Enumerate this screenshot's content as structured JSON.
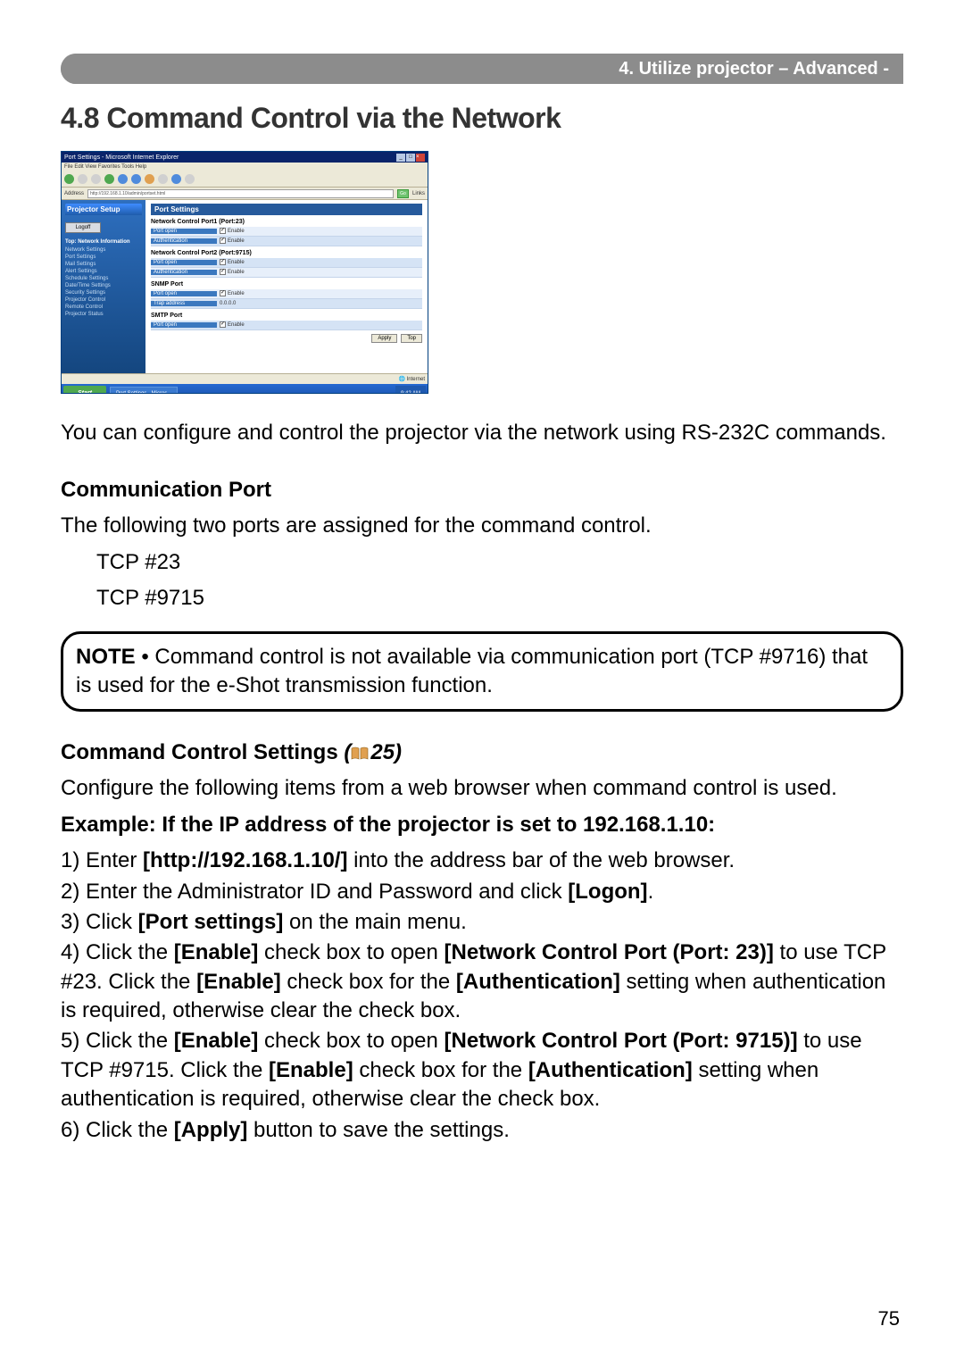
{
  "header": {
    "breadcrumb": "4. Utilize projector – Advanced -"
  },
  "title": "4.8 Command Control via the Network",
  "screenshot": {
    "window_title": "Port Settings - Microsoft Internet Explorer",
    "menu": "File  Edit  View  Favorites  Tools  Help",
    "address": "http://192.168.1.10/admin/portset.html",
    "go": "Go",
    "sidebar_header": "Projector Setup",
    "logoff": "Logoff",
    "sidebar_top": "Top: Network Information",
    "sidebar_items": [
      "Network Settings",
      "Port Settings",
      "Mail Settings",
      "Alert Settings",
      "Schedule Settings",
      "Date/Time Settings",
      "Security Settings",
      "Projector Control",
      "Remote Control",
      "Projector Status"
    ],
    "content_title": "Port Settings",
    "sec1": "Network Control Port1 (Port:23)",
    "row_port_open": "Port open",
    "row_auth": "Authentication",
    "enable": "Enable",
    "sec2": "Network Control Port2 (Port:9715)",
    "sec3": "SNMP Port",
    "trap_addr_label": "Trap address",
    "trap_addr_value": "0.0.0.0",
    "sec4": "SMTP Port",
    "apply": "Apply",
    "top_btn": "Top",
    "status_internet": "Internet",
    "taskbar_start": "Start",
    "taskbar_task": "Port Settings - Micros...",
    "taskbar_time": "9:42 AM"
  },
  "intro": "You can configure and control the projector via the network using RS-232C commands.",
  "comm_port": {
    "heading": "Communication Port",
    "text": "The following two ports are assigned for the command control.",
    "p1": "TCP #23",
    "p2": "TCP #9715"
  },
  "note": {
    "label": "NOTE",
    "text": " • Command control is not available via communication port (TCP #9716) that is used for the e-Shot transmission function."
  },
  "ccs": {
    "heading": "Command Control Settings ",
    "ref": "25",
    "intro": "Configure the following items from a web browser when command control is used.",
    "example": "Example: If the IP address of the projector is set to 192.168.1.10:",
    "s1a": "1) Enter ",
    "s1b": "[http://192.168.1.10/]",
    "s1c": " into the address bar of the web browser.",
    "s2a": "2) Enter the Administrator ID and Password and click ",
    "s2b": "[Logon]",
    "s2c": ".",
    "s3a": "3) Click ",
    "s3b": "[Port settings]",
    "s3c": " on the main menu.",
    "s4a": "4) Click the ",
    "s4b": "[Enable]",
    "s4c": " check box to open ",
    "s4d": "[Network Control Port (Port: 23)]",
    "s4e": " to use TCP #23. Click the ",
    "s4f": "[Enable]",
    "s4g": " check box for the ",
    "s4h": "[Authentication]",
    "s4i": " setting when authentication is required, otherwise clear the check box.",
    "s5a": "5) Click the ",
    "s5b": "[Enable]",
    "s5c": " check box to open ",
    "s5d": "[Network Control Port (Port: 9715)]",
    "s5e": " to use TCP #9715. Click the ",
    "s5f": "[Enable]",
    "s5g": " check box for the ",
    "s5h": "[Authentication]",
    "s5i": " setting when authentication is required, otherwise clear the check box.",
    "s6a": "6) Click the ",
    "s6b": "[Apply]",
    "s6c": " button to save the settings."
  },
  "pagenum": "75"
}
